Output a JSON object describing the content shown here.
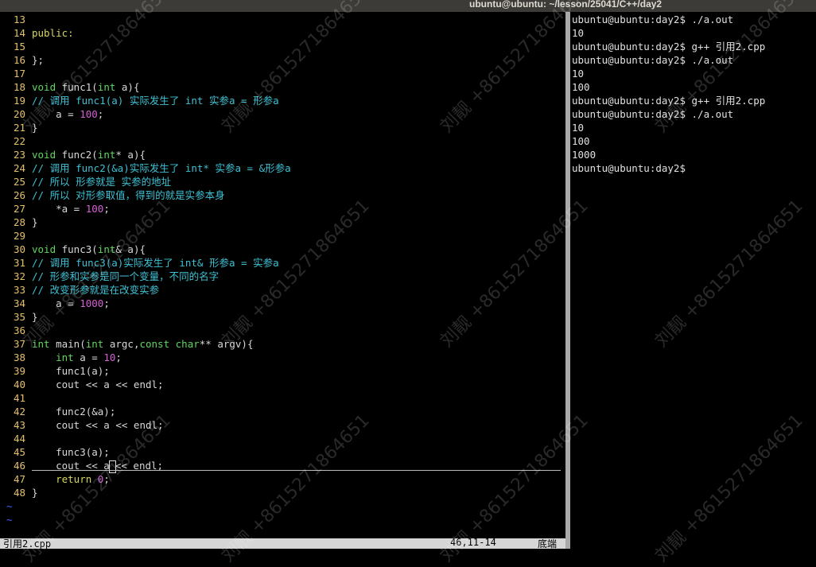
{
  "window": {
    "title": "ubuntu@ubuntu: ~/lesson/25041/C++/day2"
  },
  "editor": {
    "lines": [
      {
        "n": "13",
        "segs": []
      },
      {
        "n": "14",
        "segs": [
          {
            "t": "public:",
            "c": "kw"
          }
        ]
      },
      {
        "n": "15",
        "segs": []
      },
      {
        "n": "16",
        "segs": [
          {
            "t": "};",
            "c": ""
          }
        ]
      },
      {
        "n": "17",
        "segs": []
      },
      {
        "n": "18",
        "segs": [
          {
            "t": "void",
            "c": "type"
          },
          {
            "t": " func1(",
            "c": ""
          },
          {
            "t": "int",
            "c": "type"
          },
          {
            "t": " a){",
            "c": ""
          }
        ]
      },
      {
        "n": "19",
        "segs": [
          {
            "t": "// 调用 func1(a) 实际发生了 int 实参a = 形参a",
            "c": "cmt"
          }
        ]
      },
      {
        "n": "20",
        "segs": [
          {
            "t": "    a = ",
            "c": ""
          },
          {
            "t": "100",
            "c": "num"
          },
          {
            "t": ";",
            "c": ""
          }
        ]
      },
      {
        "n": "21",
        "segs": [
          {
            "t": "}",
            "c": ""
          }
        ]
      },
      {
        "n": "22",
        "segs": []
      },
      {
        "n": "23",
        "segs": [
          {
            "t": "void",
            "c": "type"
          },
          {
            "t": " func2(",
            "c": ""
          },
          {
            "t": "int",
            "c": "type"
          },
          {
            "t": "* a){",
            "c": ""
          }
        ]
      },
      {
        "n": "24",
        "segs": [
          {
            "t": "// 调用 func2(&a)实际发生了 int* 实参a = &形参a",
            "c": "cmt"
          }
        ]
      },
      {
        "n": "25",
        "segs": [
          {
            "t": "// 所以 形参就是 实参的地址",
            "c": "cmt"
          }
        ]
      },
      {
        "n": "26",
        "segs": [
          {
            "t": "// 所以 对形参取值，得到的就是实参本身",
            "c": "cmt"
          }
        ]
      },
      {
        "n": "27",
        "segs": [
          {
            "t": "    *a = ",
            "c": ""
          },
          {
            "t": "100",
            "c": "num"
          },
          {
            "t": ";",
            "c": ""
          }
        ]
      },
      {
        "n": "28",
        "segs": [
          {
            "t": "}",
            "c": ""
          }
        ]
      },
      {
        "n": "29",
        "segs": []
      },
      {
        "n": "30",
        "segs": [
          {
            "t": "void",
            "c": "type"
          },
          {
            "t": " func3(",
            "c": ""
          },
          {
            "t": "int",
            "c": "type"
          },
          {
            "t": "& a){",
            "c": ""
          }
        ]
      },
      {
        "n": "31",
        "segs": [
          {
            "t": "// 调用 func3(a)实际发生了 int& 形参a = 实参a",
            "c": "cmt"
          }
        ]
      },
      {
        "n": "32",
        "segs": [
          {
            "t": "// 形参和实参是同一个变量，不同的名字",
            "c": "cmt"
          }
        ]
      },
      {
        "n": "33",
        "segs": [
          {
            "t": "// 改变形参就是在改变实参",
            "c": "cmt"
          }
        ]
      },
      {
        "n": "34",
        "segs": [
          {
            "t": "    a = ",
            "c": ""
          },
          {
            "t": "1000",
            "c": "num"
          },
          {
            "t": ";",
            "c": ""
          }
        ]
      },
      {
        "n": "35",
        "segs": [
          {
            "t": "}",
            "c": ""
          }
        ]
      },
      {
        "n": "36",
        "segs": []
      },
      {
        "n": "37",
        "segs": [
          {
            "t": "int",
            "c": "type"
          },
          {
            "t": " main(",
            "c": ""
          },
          {
            "t": "int",
            "c": "type"
          },
          {
            "t": " argc,",
            "c": ""
          },
          {
            "t": "const",
            "c": "type"
          },
          {
            "t": " ",
            "c": ""
          },
          {
            "t": "char",
            "c": "type"
          },
          {
            "t": "** argv){",
            "c": ""
          }
        ]
      },
      {
        "n": "38",
        "segs": [
          {
            "t": "    ",
            "c": ""
          },
          {
            "t": "int",
            "c": "type"
          },
          {
            "t": " a = ",
            "c": ""
          },
          {
            "t": "10",
            "c": "num"
          },
          {
            "t": ";",
            "c": ""
          }
        ]
      },
      {
        "n": "39",
        "segs": [
          {
            "t": "    func1(a);",
            "c": ""
          }
        ]
      },
      {
        "n": "40",
        "segs": [
          {
            "t": "    cout << a << endl;",
            "c": ""
          }
        ]
      },
      {
        "n": "41",
        "segs": []
      },
      {
        "n": "42",
        "segs": [
          {
            "t": "    func2(&a);",
            "c": ""
          }
        ]
      },
      {
        "n": "43",
        "segs": [
          {
            "t": "    cout << a << endl;",
            "c": ""
          }
        ]
      },
      {
        "n": "44",
        "segs": []
      },
      {
        "n": "45",
        "segs": [
          {
            "t": "    func3(a);",
            "c": ""
          }
        ]
      },
      {
        "n": "46",
        "segs": [
          {
            "t": "    cout << a",
            "c": ""
          },
          {
            "t": "CURSOR",
            "c": "cursor"
          },
          {
            "t": "<< endl;",
            "c": ""
          }
        ]
      },
      {
        "n": "47",
        "segs": [
          {
            "t": "    ",
            "c": ""
          },
          {
            "t": "return",
            "c": "kw"
          },
          {
            "t": " ",
            "c": ""
          },
          {
            "t": "0",
            "c": "num"
          },
          {
            "t": ";",
            "c": ""
          }
        ]
      },
      {
        "n": "48",
        "segs": [
          {
            "t": "}",
            "c": ""
          }
        ]
      }
    ],
    "tildes": [
      "~",
      "~"
    ]
  },
  "status": {
    "file": "引用2.cpp",
    "position": "46,11-14",
    "scroll": "底端"
  },
  "terminal": {
    "lines": [
      "ubuntu@ubuntu:day2$ ./a.out",
      "10",
      "ubuntu@ubuntu:day2$ g++ 引用2.cpp",
      "ubuntu@ubuntu:day2$ ./a.out",
      "10",
      "100",
      "ubuntu@ubuntu:day2$ g++ 引用2.cpp",
      "ubuntu@ubuntu:day2$ ./a.out",
      "10",
      "100",
      "1000",
      "ubuntu@ubuntu:day2$ "
    ]
  },
  "watermark": {
    "text": "刘靓 +8615271864651"
  },
  "colors": {
    "linenumber": "#e5c06b",
    "type": "#5fd75f",
    "keyword": "#d7d75f",
    "number": "#d75fd7",
    "comment": "#3ec1d3",
    "tilde": "#4060ff"
  }
}
